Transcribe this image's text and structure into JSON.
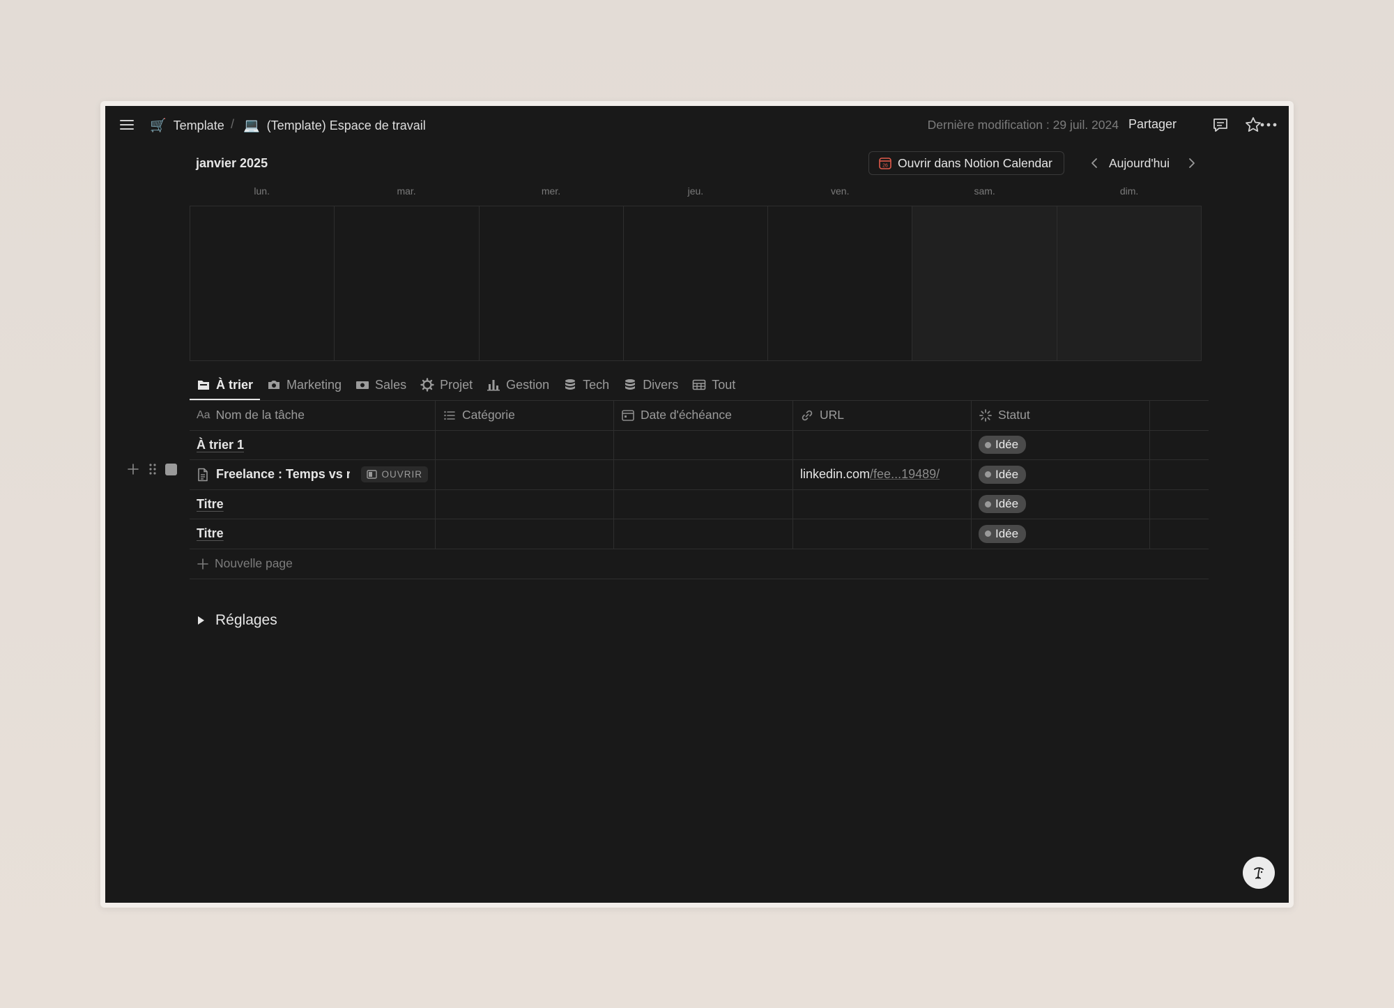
{
  "topbar": {
    "breadcrumb": [
      {
        "emoji": "🛒",
        "label": "Template"
      },
      {
        "emoji": "💻",
        "label": "(Template) Espace de travail"
      }
    ],
    "separator": "/",
    "last_modified": "Dernière modification : 29 juil. 2024",
    "share_label": "Partager",
    "icons": [
      "menu-icon",
      "comment-icon",
      "star-icon",
      "more-icon"
    ]
  },
  "calendar": {
    "month_label": "janvier 2025",
    "open_button_label": "Ouvrir dans Notion Calendar",
    "open_button_icon_text": "26",
    "today_label": "Aujourd'hui",
    "weekdays": [
      "lun.",
      "mar.",
      "mer.",
      "jeu.",
      "ven.",
      "sam.",
      "dim."
    ]
  },
  "tabs": [
    {
      "label": "À trier",
      "icon": "inbox-icon",
      "active": true
    },
    {
      "label": "Marketing",
      "icon": "camera-icon",
      "active": false
    },
    {
      "label": "Sales",
      "icon": "money-icon",
      "active": false
    },
    {
      "label": "Projet",
      "icon": "gear-icon",
      "active": false
    },
    {
      "label": "Gestion",
      "icon": "bar-chart-icon",
      "active": false
    },
    {
      "label": "Tech",
      "icon": "database-icon",
      "active": false
    },
    {
      "label": "Divers",
      "icon": "database-icon",
      "active": false
    },
    {
      "label": "Tout",
      "icon": "table-icon",
      "active": false
    }
  ],
  "table": {
    "columns": [
      {
        "label": "Nom de la tâche",
        "icon_text": "Aa"
      },
      {
        "label": "Catégorie",
        "icon": "list-icon"
      },
      {
        "label": "Date d'échéance",
        "icon": "calendar-icon"
      },
      {
        "label": "URL",
        "icon": "link-icon"
      },
      {
        "label": "Statut",
        "icon": "status-icon"
      }
    ],
    "rows": [
      {
        "name": "À trier 1",
        "url_main": "",
        "url_rest": "",
        "status": "Idée"
      },
      {
        "name": "Freelance : Temps vs rés",
        "open_label": "OUVRIR",
        "url_main": "linkedin.com",
        "url_rest": "/fee...19489/",
        "status": "Idée"
      },
      {
        "name": "Titre",
        "url_main": "",
        "url_rest": "",
        "status": "Idée"
      },
      {
        "name": "Titre",
        "url_main": "",
        "url_rest": "",
        "status": "Idée"
      }
    ],
    "new_page_label": "Nouvelle page"
  },
  "settings_label": "Réglages",
  "colors": {
    "background": "#191919",
    "badge": "#4a4a4a",
    "calendar_icon": "#e05a4a"
  }
}
